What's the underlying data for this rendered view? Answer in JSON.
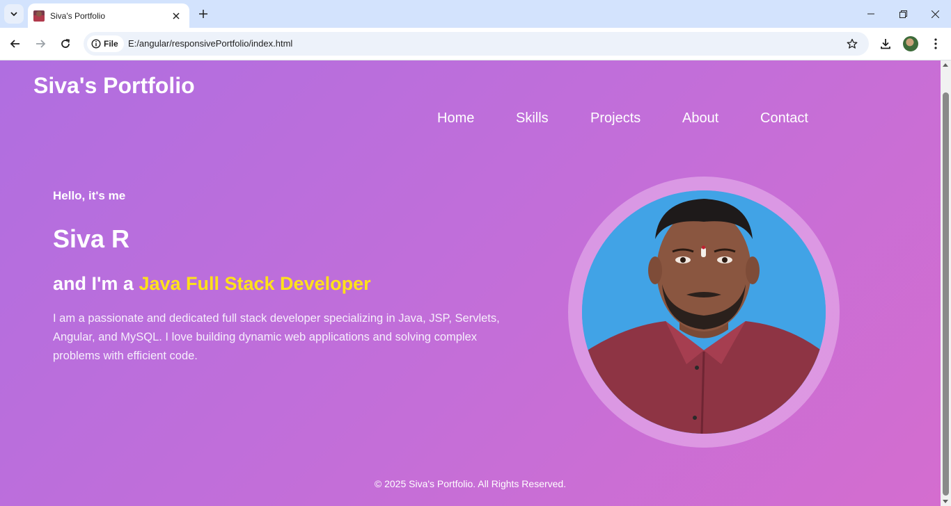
{
  "browser": {
    "tab_title": "Siva's Portfolio",
    "site_chip": "File",
    "url": "E:/angular/responsivePortfolio/index.html"
  },
  "page": {
    "logo": "Siva's Portfolio",
    "nav": [
      "Home",
      "Skills",
      "Projects",
      "About",
      "Contact"
    ],
    "hero": {
      "greeting": "Hello, it's me",
      "name": "Siva R",
      "role_prefix": "and I'm a ",
      "role_highlight": "Java Full Stack Developer",
      "bio": "I am a passionate and dedicated full stack developer specializing in Java, JSP, Servlets, Angular, and MySQL. I love building dynamic web applications and solving complex problems with efficient code."
    },
    "footer": "© 2025 Siva's Portfolio. All Rights Reserved."
  },
  "colors": {
    "gradient_start": "#b06ee0",
    "gradient_end": "#d46dcf",
    "highlight": "#ffe11a",
    "photo_background": "#41a3e6"
  },
  "icons": [
    "tab-search-icon",
    "close-icon",
    "plus-icon",
    "minimize-icon",
    "restore-icon",
    "window-close-icon",
    "back-arrow-icon",
    "forward-arrow-icon",
    "reload-icon",
    "info-icon",
    "star-icon",
    "download-icon",
    "kebab-menu-icon"
  ]
}
